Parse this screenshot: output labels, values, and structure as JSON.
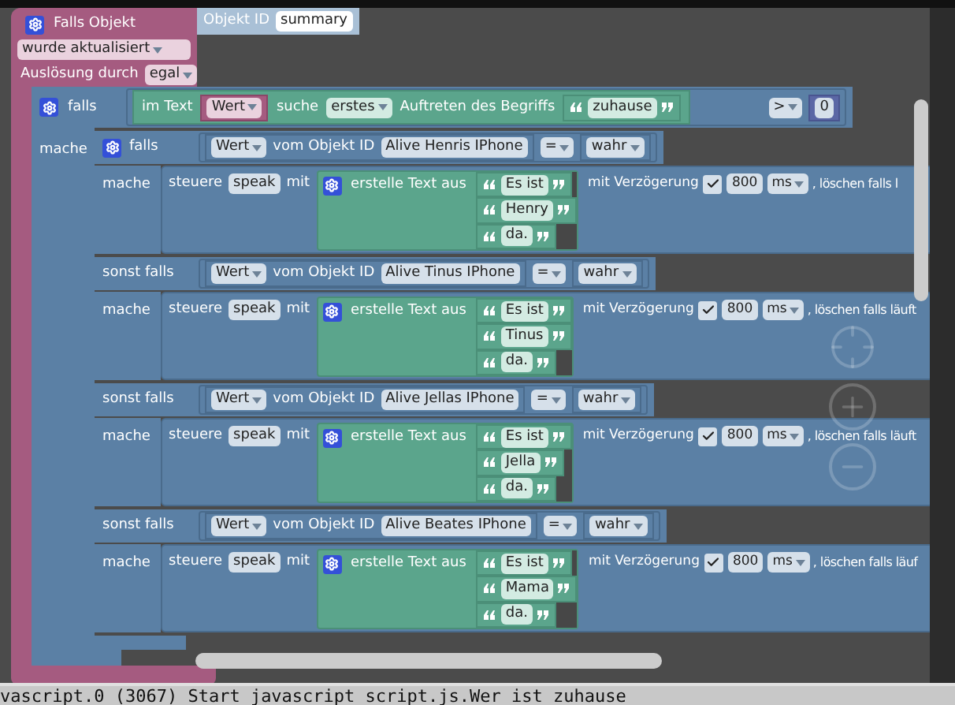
{
  "trigger": {
    "title": "Falls Objekt",
    "event": "wurde aktualisiert",
    "trigger_label": "Auslösung durch",
    "trigger_value": "egal",
    "object_id": {
      "label": "Objekt ID",
      "value": "summary"
    }
  },
  "if_block": {
    "label": "falls",
    "do_label": "mache",
    "condition": {
      "prefix": "im Text",
      "variable": "Wert",
      "search_label": "suche",
      "occurrence": "erstes",
      "middle": "Auftreten des Begriffs",
      "term": "zuhause",
      "operator": ">",
      "number": "0"
    }
  },
  "branches": [
    {
      "label": "falls",
      "do_label": "mache",
      "field": "Wert",
      "middle": "vom Objekt ID",
      "object": "Alive Henris IPhone",
      "operator": "=",
      "value": "wahr",
      "action": {
        "verb": "steuere",
        "target": "speak",
        "with": "mit",
        "join_label": "erstelle Text aus",
        "parts": [
          "Es ist",
          "Henry",
          "da."
        ],
        "delay_label": "mit Verzögerung",
        "delay_checked": true,
        "delay": "800",
        "unit": "ms",
        "tail": ", löschen falls l"
      }
    },
    {
      "label": "sonst falls",
      "do_label": "mache",
      "field": "Wert",
      "middle": "vom Objekt ID",
      "object": "Alive Tinus IPhone",
      "operator": "=",
      "value": "wahr",
      "action": {
        "verb": "steuere",
        "target": "speak",
        "with": "mit",
        "join_label": "erstelle Text aus",
        "parts": [
          "Es ist",
          "Tinus",
          "da."
        ],
        "delay_label": "mit Verzögerung",
        "delay_checked": true,
        "delay": "800",
        "unit": "ms",
        "tail": ", löschen falls läuft"
      }
    },
    {
      "label": "sonst falls",
      "do_label": "mache",
      "field": "Wert",
      "middle": "vom Objekt ID",
      "object": "Alive Jellas IPhone",
      "operator": "=",
      "value": "wahr",
      "action": {
        "verb": "steuere",
        "target": "speak",
        "with": "mit",
        "join_label": "erstelle Text aus",
        "parts": [
          "Es ist",
          "Jella",
          "da."
        ],
        "delay_label": "mit Verzögerung",
        "delay_checked": true,
        "delay": "800",
        "unit": "ms",
        "tail": ", löschen falls läuft"
      }
    },
    {
      "label": "sonst falls",
      "do_label": "mache",
      "field": "Wert",
      "middle": "vom Objekt ID",
      "object": "Alive Beates IPhone",
      "operator": "=",
      "value": "wahr",
      "action": {
        "verb": "steuere",
        "target": "speak",
        "with": "mit",
        "join_label": "erstelle Text aus",
        "parts": [
          "Es ist",
          "Mama",
          "da."
        ],
        "delay_label": "mit Verzögerung",
        "delay_checked": true,
        "delay": "800",
        "unit": "ms",
        "tail": ", löschen falls läuf"
      }
    }
  ],
  "log": "vascript.0 (3067) Start javascript script.js.Wer ist zuhause"
}
